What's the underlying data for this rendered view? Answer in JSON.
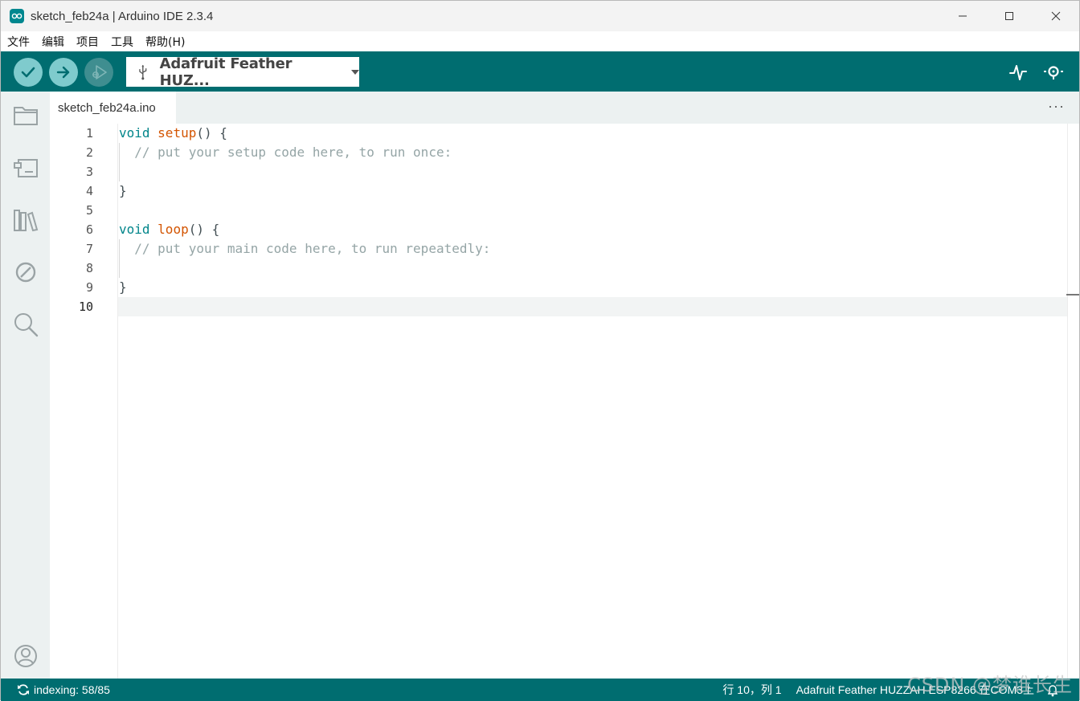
{
  "window": {
    "title": "sketch_feb24a | Arduino IDE 2.3.4",
    "app_icon": "arduino-logo-icon",
    "controls": [
      "minimize-icon",
      "maximize-icon",
      "close-icon"
    ]
  },
  "menu": {
    "items": [
      "文件",
      "编辑",
      "项目",
      "工具",
      "帮助(H)"
    ]
  },
  "toolbar": {
    "verify_icon": "checkmark-icon",
    "upload_icon": "arrow-right-icon",
    "debug_icon": "debug-icon",
    "board_icon": "usb-icon",
    "board_name": "Adafruit Feather HUZ...",
    "serial_plotter_icon": "pulse-icon",
    "serial_monitor_icon": "magnifier-icon"
  },
  "sidebar": {
    "items": [
      "folder-icon",
      "board-manager-icon",
      "library-icon",
      "debug-disabled-icon",
      "search-icon"
    ],
    "bottom": "account-icon"
  },
  "tabs": {
    "items": [
      {
        "label": "sketch_feb24a.ino"
      }
    ],
    "more": "···"
  },
  "editor": {
    "line_numbers": [
      "1",
      "2",
      "3",
      "4",
      "5",
      "6",
      "7",
      "8",
      "9",
      "10"
    ],
    "current_line": 10,
    "lines": [
      [
        {
          "t": "kw",
          "v": "void"
        },
        {
          "t": "pl",
          "v": " "
        },
        {
          "t": "fn",
          "v": "setup"
        },
        {
          "t": "pl",
          "v": "() {"
        }
      ],
      [
        {
          "t": "cm",
          "v": "  // put your setup code here, to run once:"
        }
      ],
      [],
      [
        {
          "t": "pl",
          "v": "}"
        }
      ],
      [],
      [
        {
          "t": "kw",
          "v": "void"
        },
        {
          "t": "pl",
          "v": " "
        },
        {
          "t": "fn",
          "v": "loop"
        },
        {
          "t": "pl",
          "v": "() {"
        }
      ],
      [
        {
          "t": "cm",
          "v": "  // put your main code here, to run repeatedly:"
        }
      ],
      [],
      [
        {
          "t": "pl",
          "v": "}"
        }
      ],
      []
    ]
  },
  "statusbar": {
    "indexing": "indexing: 58/85",
    "position": "行 10，列 1",
    "board": "Adafruit Feather HUZZAH ESP8266 在COM3上",
    "sync_icon": "sync-icon",
    "notification_icon": "bell-icon"
  },
  "watermark": "CSDN @梦谁长生",
  "colors": {
    "teal": "#006d70",
    "button": "#7fcbcd",
    "keyword": "#00858a",
    "function": "#d35400",
    "comment": "#95a5a6"
  }
}
